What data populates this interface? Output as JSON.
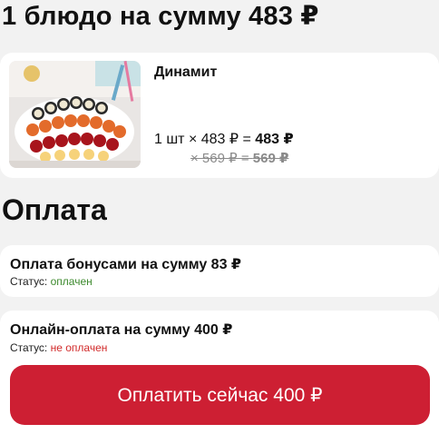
{
  "order": {
    "title": "1 блюдо на сумму 483 ₽"
  },
  "item": {
    "name": "Динамит",
    "price_line": "1 шт × 483 ₽ = ",
    "total": "483 ₽",
    "old_price_line": "× 569 ₽ = ",
    "old_total": "569 ₽"
  },
  "payment": {
    "title": "Оплата",
    "status_label": "Статус: ",
    "bonus": {
      "title": "Оплата бонусами на сумму 83 ₽",
      "status": "оплачен",
      "status_color": "#3d8a2e"
    },
    "online": {
      "title": "Онлайн-оплата на сумму 400 ₽",
      "status": "не оплачен",
      "status_color": "#d12b2b",
      "pay_button": "Оплатить сейчас 400 ₽",
      "button_color": "#cd1f33"
    }
  }
}
